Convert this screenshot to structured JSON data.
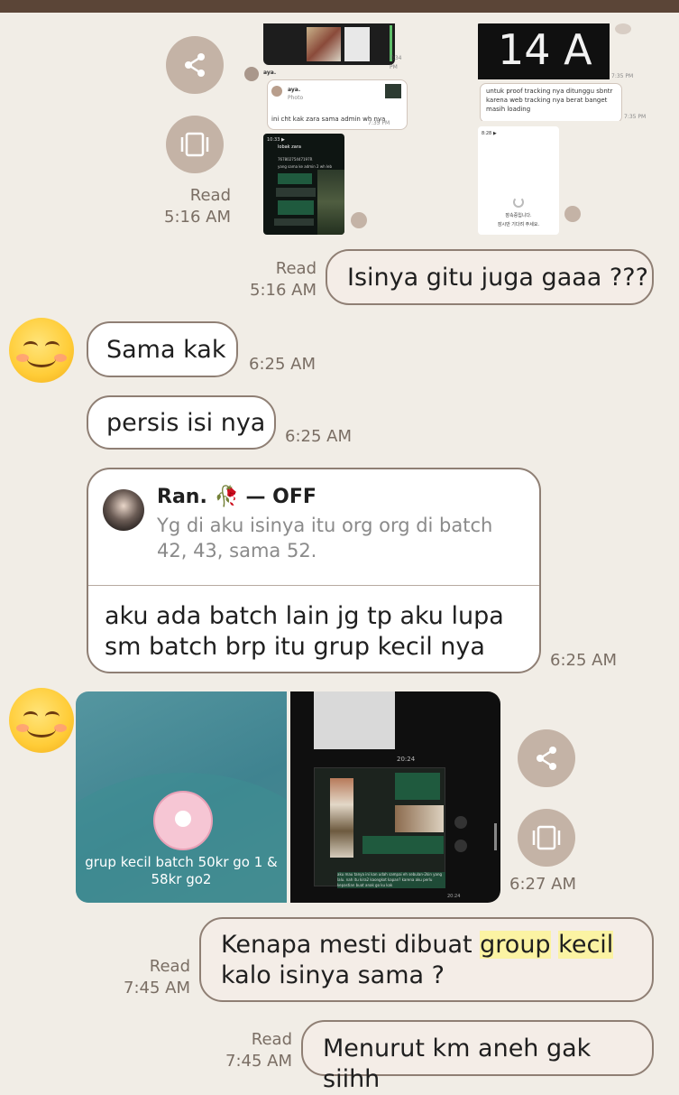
{
  "top_left": {
    "read": "Read",
    "time": "5:16 AM",
    "ss1_time_a": "7:34 PM",
    "ss1_sender": "aya.",
    "ss1_quote_name": "aya.",
    "ss1_quote_sub": "Photo",
    "ss1_msg": "ini cht kak zara sama admin wh nya",
    "ss1_time_b": "7:35 PM",
    "ss3_status": "10:33 ▶",
    "ss3_title": "lobak zara",
    "ss3_number": "76780275447197R",
    "ss3_line": "yang sama ke admin 2 wh leb",
    "ss2_big": "14 A",
    "ss2_time_a": "7:35 PM",
    "ss2_msg": "untuk proof tracking nya ditunggu sbntr karena web tracking nya berat banget masih loading",
    "ss2_time_b": "7:35 PM",
    "ss4_status": "8:28 ▶",
    "ss4_line1": "잠속중입니다.",
    "ss4_line2": "잠시만 기다려 주세요."
  },
  "msg_isinya": {
    "read": "Read",
    "time": "5:16 AM",
    "text": "Isinya gitu juga gaaa ???"
  },
  "msg_sama": {
    "text": "Sama kak",
    "time": "6:25 AM"
  },
  "msg_persis": {
    "text": "persis isi nya",
    "time": "6:25 AM"
  },
  "msg_reply": {
    "quote_name": "Ran. 🥀 — OFF",
    "quote_text": "Yg di aku isinya itu org org di batch 42, 43, sama 52.",
    "text": "aku ada batch lain jg tp aku lupa sm batch brp itu grup kecil nya",
    "time": "6:25 AM"
  },
  "media": {
    "group_caption": "grup kecil batch 50kr go 1 & 58kr go2",
    "ss5_time_a": "20:24",
    "ss5_time_b": "20:24",
    "ss5_msg": "aku mau tanya ini kan udah sampai eh sebulan-2kin yang lalu. nah itu kira2 kaongkot kapan? karena aku perlu kepastian buat anak go ku kak",
    "time": "6:27 AM"
  },
  "msg_kenapa": {
    "read": "Read",
    "time": "7:45 AM",
    "t1": "Kenapa mesti dibuat ",
    "t2": "group",
    "t3": " ",
    "t4": "kecil",
    "t5": "kalo isinya sama ?"
  },
  "msg_menurut": {
    "read": "Read",
    "time": "7:45 AM",
    "text": "Menurut km aneh gak siihh"
  },
  "icons": [
    "share-icon",
    "gallery-icon",
    "smiling-face-emoji",
    "avatar",
    "rose-emoji"
  ],
  "colors": {
    "background": "#f1ede6",
    "topbar": "#5b4537",
    "bubble_border": "#8f7f74",
    "action_circle": "#c4b3a6",
    "highlight": "#fbf3a3"
  }
}
